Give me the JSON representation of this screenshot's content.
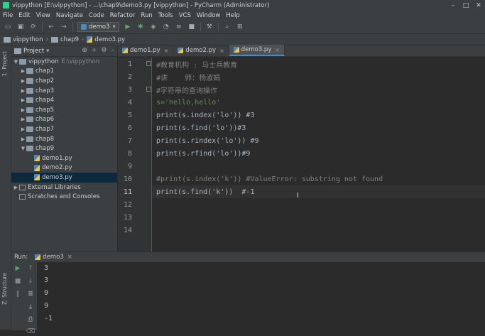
{
  "window": {
    "title": "vippython [E:\\vippython] - ...\\chap9\\demo3.py [vippython] - PyCharm (Administrator)"
  },
  "menu": [
    "File",
    "Edit",
    "View",
    "Navigate",
    "Code",
    "Refactor",
    "Run",
    "Tools",
    "VCS",
    "Window",
    "Help"
  ],
  "toolbar": {
    "run_config": "demo3"
  },
  "breadcrumb": [
    "vippython",
    "chap9",
    "demo3.py"
  ],
  "side_tabs": {
    "project": "1: Project",
    "structure": "Z: Structure"
  },
  "project_panel": {
    "header": "Project",
    "tree": [
      {
        "label": "vippython",
        "extra": "E:\\vippython",
        "type": "root"
      },
      {
        "label": "chap1",
        "type": "folder"
      },
      {
        "label": "chap2",
        "type": "folder"
      },
      {
        "label": "chap3",
        "type": "folder"
      },
      {
        "label": "chap4",
        "type": "folder"
      },
      {
        "label": "chap5",
        "type": "folder"
      },
      {
        "label": "chap6",
        "type": "folder"
      },
      {
        "label": "chap7",
        "type": "folder"
      },
      {
        "label": "chap8",
        "type": "folder"
      },
      {
        "label": "chap9",
        "type": "folder-open"
      },
      {
        "label": "demo1.py",
        "type": "file"
      },
      {
        "label": "demo2.py",
        "type": "file"
      },
      {
        "label": "demo3.py",
        "type": "file",
        "selected": true
      },
      {
        "label": "External Libraries",
        "type": "lib"
      },
      {
        "label": "Scratches and Consoles",
        "type": "scratch"
      }
    ]
  },
  "editor": {
    "tabs": [
      "demo1.py",
      "demo2.py",
      "demo3.py"
    ],
    "active_tab": "demo3.py",
    "lines": [
      "#教育机构 : 马士兵教育",
      "#讲    师：杨淑娟",
      "#字符串的查询操作",
      "s='hello,hello'",
      "print(s.index('lo')) #3",
      "print(s.find('lo'))#3",
      "print(s.rindex('lo')) #9",
      "print(s.rfind('lo'))#9",
      "",
      "#print(s.index('k')) #ValueError: substring not found",
      "print(s.find('k'))  #-1",
      "",
      "",
      ""
    ],
    "current_line": 11
  },
  "run": {
    "label": "Run:",
    "config": "demo3",
    "output": [
      "3",
      "3",
      "9",
      "9",
      "-1"
    ]
  }
}
